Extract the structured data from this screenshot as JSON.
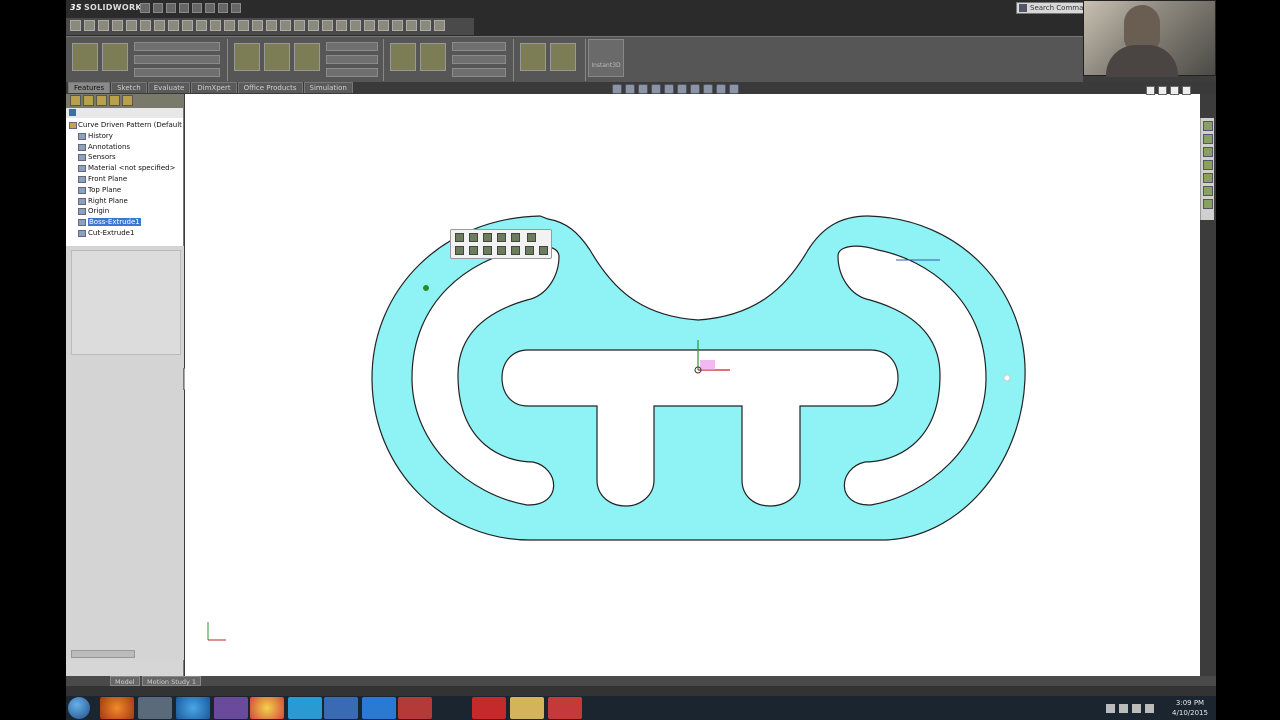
{
  "app": {
    "brand": "SOLIDWORKS",
    "brand_prefix": "3S",
    "search_placeholder": "Search Commands"
  },
  "command_tabs": [
    {
      "label": "Features",
      "active": true
    },
    {
      "label": "Sketch",
      "active": false
    },
    {
      "label": "Evaluate",
      "active": false
    },
    {
      "label": "DimXpert",
      "active": false
    },
    {
      "label": "Office Products",
      "active": false
    },
    {
      "label": "Simulation",
      "active": false
    }
  ],
  "command_manager": {
    "instant3d_label": "Instant3D"
  },
  "feature_tree": {
    "root": "Curve Driven Pattern  (Default",
    "items": [
      {
        "label": "History",
        "icon": "history-icon",
        "selected": false
      },
      {
        "label": "Annotations",
        "icon": "annotations-icon",
        "selected": false
      },
      {
        "label": "Sensors",
        "icon": "sensors-icon",
        "selected": false
      },
      {
        "label": "Material <not specified>",
        "icon": "material-icon",
        "selected": false
      },
      {
        "label": "Front Plane",
        "icon": "plane-icon",
        "selected": false
      },
      {
        "label": "Top Plane",
        "icon": "plane-icon",
        "selected": false
      },
      {
        "label": "Right Plane",
        "icon": "plane-icon",
        "selected": false
      },
      {
        "label": "Origin",
        "icon": "origin-icon",
        "selected": false
      },
      {
        "label": "Boss-Extrude1",
        "icon": "extrude-icon",
        "selected": true
      },
      {
        "label": "Cut-Extrude1",
        "icon": "cut-icon",
        "selected": false
      }
    ]
  },
  "bottom_tabs": {
    "model": "Model",
    "motion": "Motion Study 1"
  },
  "model": {
    "part_color": "#8ff3f6",
    "edge_color": "#222222"
  },
  "taskbar": {
    "time": "3:09 PM",
    "date": "4/10/2015",
    "apps": [
      "firefox-icon",
      "tools-icon",
      "ie-icon",
      "arrow-icon",
      "chrome-icon",
      "skype-icon",
      "outlook-icon",
      "zoom-icon",
      "acrobat-icon",
      "pdf-icon",
      "explorer-icon",
      "solidworks-icon"
    ]
  }
}
